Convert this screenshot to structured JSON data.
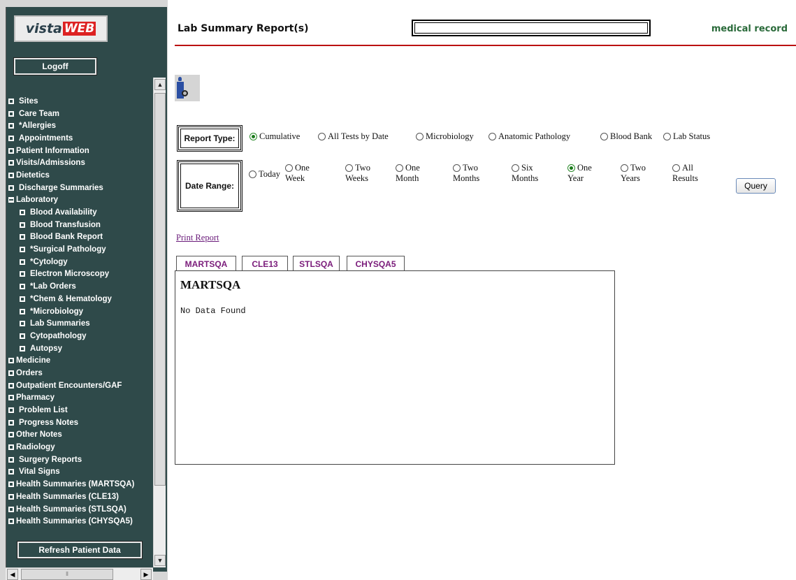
{
  "app": {
    "logo_text": "vista",
    "logo_accent": "WEB"
  },
  "sidebar": {
    "logoff_label": "Logoff",
    "refresh_label": "Refresh Patient Data",
    "items": [
      {
        "label": "Sites",
        "level": 0,
        "expanded": false,
        "tight": false
      },
      {
        "label": "Care Team",
        "level": 0,
        "expanded": false,
        "tight": false
      },
      {
        "label": "*Allergies",
        "level": 0,
        "expanded": false,
        "tight": false
      },
      {
        "label": "Appointments",
        "level": 0,
        "expanded": false,
        "tight": false
      },
      {
        "label": "Patient Information",
        "level": 0,
        "expanded": false,
        "tight": true
      },
      {
        "label": "Visits/Admissions",
        "level": 0,
        "expanded": false,
        "tight": true
      },
      {
        "label": "Dietetics",
        "level": 0,
        "expanded": false,
        "tight": true
      },
      {
        "label": "Discharge Summaries",
        "level": 0,
        "expanded": false,
        "tight": false
      },
      {
        "label": "Laboratory",
        "level": 0,
        "expanded": true,
        "tight": true
      },
      {
        "label": "Blood Availability",
        "level": 1,
        "expanded": false,
        "tight": false
      },
      {
        "label": "Blood Transfusion",
        "level": 1,
        "expanded": false,
        "tight": false
      },
      {
        "label": "Blood Bank Report",
        "level": 1,
        "expanded": false,
        "tight": false
      },
      {
        "label": "*Surgical Pathology",
        "level": 1,
        "expanded": false,
        "tight": false
      },
      {
        "label": "*Cytology",
        "level": 1,
        "expanded": false,
        "tight": false
      },
      {
        "label": "Electron Microscopy",
        "level": 1,
        "expanded": false,
        "tight": false
      },
      {
        "label": "*Lab Orders",
        "level": 1,
        "expanded": false,
        "tight": false
      },
      {
        "label": "*Chem & Hematology",
        "level": 1,
        "expanded": false,
        "tight": false
      },
      {
        "label": "*Microbiology",
        "level": 1,
        "expanded": false,
        "tight": false
      },
      {
        "label": "Lab Summaries",
        "level": 1,
        "expanded": false,
        "tight": false
      },
      {
        "label": "Cytopathology",
        "level": 1,
        "expanded": false,
        "tight": false
      },
      {
        "label": "Autopsy",
        "level": 1,
        "expanded": false,
        "tight": false
      },
      {
        "label": "Medicine",
        "level": 0,
        "expanded": false,
        "tight": true
      },
      {
        "label": "Orders",
        "level": 0,
        "expanded": false,
        "tight": true
      },
      {
        "label": "Outpatient Encounters/GAF",
        "level": 0,
        "expanded": false,
        "tight": true
      },
      {
        "label": "Pharmacy",
        "level": 0,
        "expanded": false,
        "tight": true
      },
      {
        "label": "Problem List",
        "level": 0,
        "expanded": false,
        "tight": false
      },
      {
        "label": "Progress Notes",
        "level": 0,
        "expanded": false,
        "tight": false
      },
      {
        "label": "Other Notes",
        "level": 0,
        "expanded": false,
        "tight": true
      },
      {
        "label": "Radiology",
        "level": 0,
        "expanded": false,
        "tight": true
      },
      {
        "label": "Surgery Reports",
        "level": 0,
        "expanded": false,
        "tight": false
      },
      {
        "label": "Vital Signs",
        "level": 0,
        "expanded": false,
        "tight": false
      },
      {
        "label": "Health Summaries (MARTSQA)",
        "level": 0,
        "expanded": false,
        "tight": true
      },
      {
        "label": "Health Summaries (CLE13)",
        "level": 0,
        "expanded": false,
        "tight": true
      },
      {
        "label": "Health Summaries (STLSQA)",
        "level": 0,
        "expanded": false,
        "tight": true
      },
      {
        "label": "Health Summaries (CHYSQA5)",
        "level": 0,
        "expanded": false,
        "tight": true
      }
    ]
  },
  "header": {
    "title": "Lab Summary Report(s)",
    "right_text": "medical record"
  },
  "report_type": {
    "label": "Report Type:",
    "options": [
      "Cumulative",
      "All Tests by Date",
      "Microbiology",
      "Anatomic Pathology",
      "Blood Bank",
      "Lab Status"
    ],
    "selected": "Cumulative"
  },
  "date_range": {
    "label": "Date Range:",
    "options": [
      {
        "line1": "Today",
        "line2": ""
      },
      {
        "line1": "One",
        "line2": "Week"
      },
      {
        "line1": "Two",
        "line2": "Weeks"
      },
      {
        "line1": "One",
        "line2": "Month"
      },
      {
        "line1": "Two",
        "line2": "Months"
      },
      {
        "line1": "Six",
        "line2": "Months"
      },
      {
        "line1": "One",
        "line2": "Year"
      },
      {
        "line1": "Two",
        "line2": "Years"
      },
      {
        "line1": "All",
        "line2": "Results"
      }
    ],
    "selected_index": 6
  },
  "query_label": "Query",
  "print_report_label": "Print Report",
  "tabs": [
    "MARTSQA",
    "CLE13",
    "STLSQA",
    "CHYSQA5"
  ],
  "active_tab": "MARTSQA",
  "panel": {
    "title": "MARTSQA",
    "message": "No Data Found"
  },
  "colors": {
    "sidebar_bg": "#2f4a4a",
    "accent_rule": "#b11111",
    "tab_text": "#7a1b7a",
    "header_right": "#2a6a3a"
  }
}
